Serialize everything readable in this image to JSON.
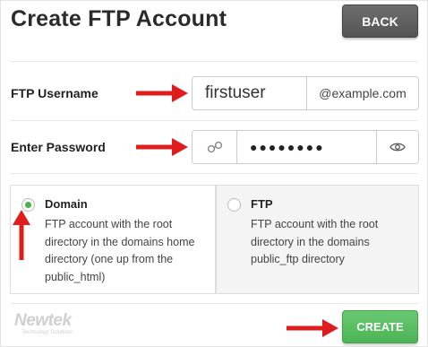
{
  "page": {
    "title": "Create FTP Account"
  },
  "header": {
    "back_label": "BACK"
  },
  "form": {
    "username": {
      "label": "FTP Username",
      "value": "firstuser",
      "domain_suffix": "@example.com"
    },
    "password": {
      "label": "Enter Password",
      "masked_value": "●●●●●●●●"
    }
  },
  "directory_options": [
    {
      "title": "Domain",
      "description": "FTP account with the root directory in the domains home directory (one up from the public_html)",
      "selected": true
    },
    {
      "title": "FTP",
      "description": "FTP account with the root directory in the domains public_ftp directory",
      "selected": false
    }
  ],
  "footer": {
    "logo_text": "Newtek",
    "logo_tagline": "Technology Solutions",
    "create_label": "CREATE"
  },
  "colors": {
    "accent_green": "#4bb456",
    "arrow_red": "#e01d1d",
    "back_gray": "#5f5f5f"
  }
}
